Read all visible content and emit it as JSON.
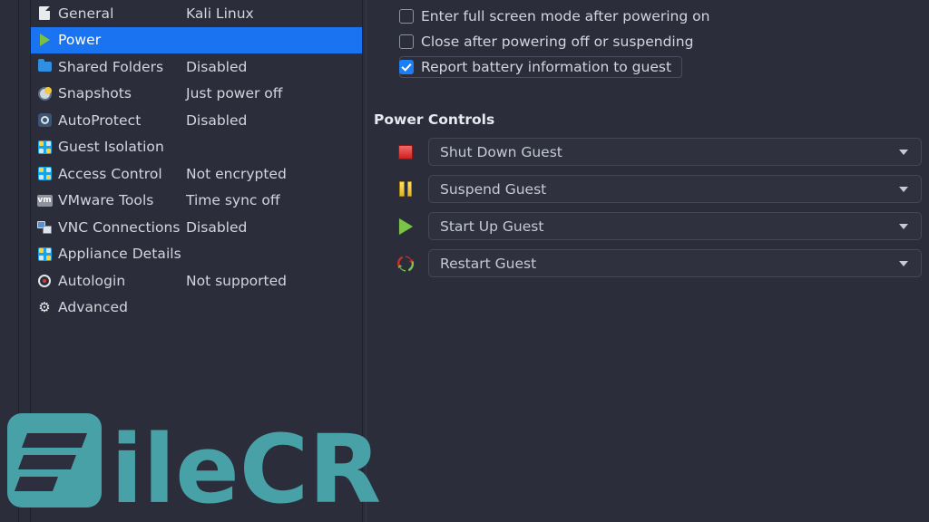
{
  "app": {
    "background_color": "#2b2d3a",
    "accent_color": "#1a73f0",
    "text_color": "#d3d6de"
  },
  "sidebar": {
    "items": [
      {
        "label": "General",
        "value": "Kali Linux",
        "icon": "document-icon",
        "selected": false
      },
      {
        "label": "Power",
        "value": "",
        "icon": "play-icon",
        "selected": true
      },
      {
        "label": "Shared Folders",
        "value": "Disabled",
        "icon": "folder-icon",
        "selected": false
      },
      {
        "label": "Snapshots",
        "value": "Just power off",
        "icon": "snapshot-icon",
        "selected": false
      },
      {
        "label": "AutoProtect",
        "value": "Disabled",
        "icon": "autoprotect-icon",
        "selected": false
      },
      {
        "label": "Guest Isolation",
        "value": "",
        "icon": "puzzle-icon",
        "selected": false
      },
      {
        "label": "Access Control",
        "value": "Not encrypted",
        "icon": "puzzle-icon",
        "selected": false
      },
      {
        "label": "VMware Tools",
        "value": "Time sync off",
        "icon": "vm-badge-icon",
        "selected": false
      },
      {
        "label": "VNC Connections",
        "value": "Disabled",
        "icon": "monitors-icon",
        "selected": false
      },
      {
        "label": "Appliance Details",
        "value": "",
        "icon": "puzzle-icon",
        "selected": false
      },
      {
        "label": "Autologin",
        "value": "Not supported",
        "icon": "autologin-icon",
        "selected": false
      },
      {
        "label": "Advanced",
        "value": "",
        "icon": "gear-icon",
        "selected": false
      }
    ]
  },
  "panel": {
    "checkboxes": [
      {
        "label": "Enter full screen mode after powering on",
        "checked": false,
        "focused": false
      },
      {
        "label": "Close after powering off or suspending",
        "checked": false,
        "focused": false
      },
      {
        "label": "Report battery information to guest",
        "checked": true,
        "focused": true
      }
    ],
    "power_controls": {
      "title": "Power Controls",
      "rows": [
        {
          "label": "Shut Down Guest",
          "icon": "stop-icon",
          "icon_color": "#d02020"
        },
        {
          "label": "Suspend Guest",
          "icon": "pause-icon",
          "icon_color": "#e0b526"
        },
        {
          "label": "Start Up Guest",
          "icon": "play-icon",
          "icon_color": "#7dc24b"
        },
        {
          "label": "Restart Guest",
          "icon": "restart-icon",
          "icon_color": "#7dc24b"
        }
      ]
    }
  },
  "watermark": {
    "text": "ileCR",
    "color": "#4aa8ad"
  }
}
